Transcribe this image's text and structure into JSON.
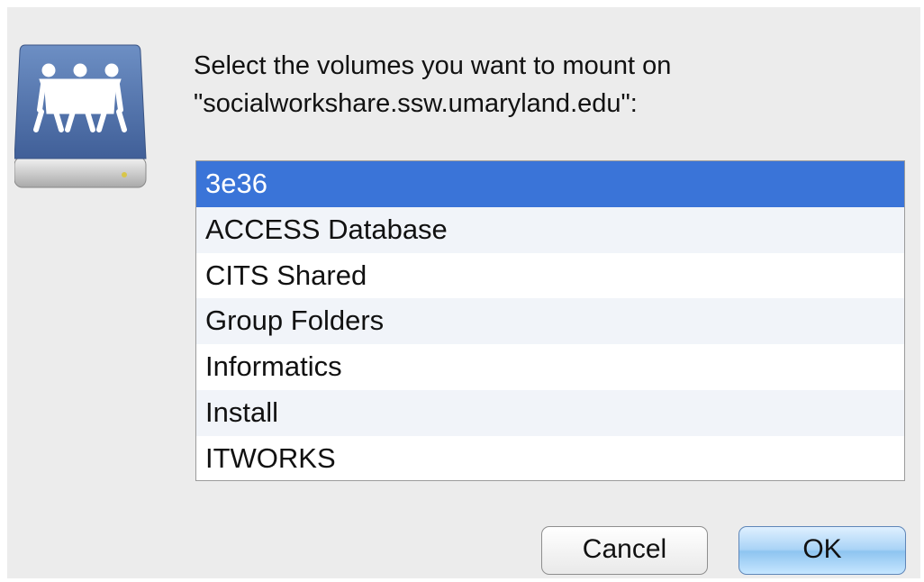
{
  "dialog": {
    "prompt_line1": "Select the volumes you want to mount on",
    "prompt_line2": "\"socialworkshare.ssw.umaryland.edu\":",
    "icon": "network-share-drive-icon"
  },
  "volumes": [
    {
      "label": "3e36",
      "selected": true
    },
    {
      "label": "ACCESS Database",
      "selected": false
    },
    {
      "label": "CITS Shared",
      "selected": false
    },
    {
      "label": "Group Folders",
      "selected": false
    },
    {
      "label": "Informatics",
      "selected": false
    },
    {
      "label": "Install",
      "selected": false
    },
    {
      "label": "ITWORKS",
      "selected": false
    }
  ],
  "buttons": {
    "cancel_label": "Cancel",
    "ok_label": "OK"
  },
  "colors": {
    "selection": "#3a74d8",
    "alt_row": "#f1f4f9",
    "dialog_bg": "#ececec",
    "default_button": "#a9d3f6"
  }
}
